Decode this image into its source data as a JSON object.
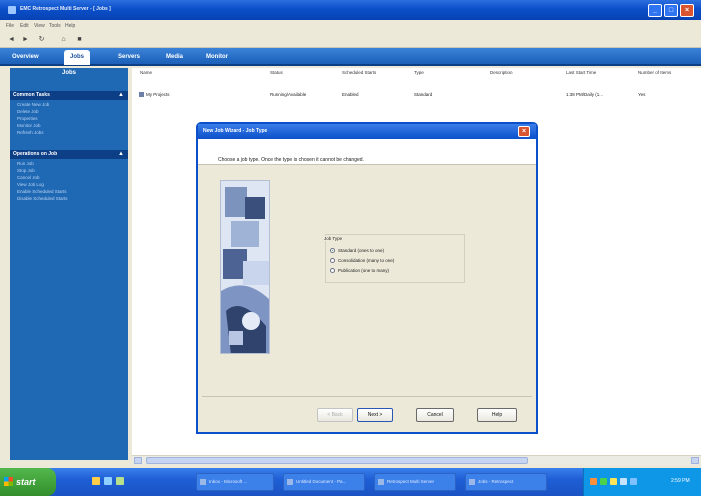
{
  "window": {
    "title": "EMC Retrospect Multi Server - [ Jobs ]"
  },
  "menu": [
    "File",
    "Edit",
    "View",
    "Tools",
    "Help"
  ],
  "toolbar": {
    "back": "◄",
    "forward": "►",
    "refresh": "↻",
    "home": "⌂",
    "stop": "■"
  },
  "nav": {
    "tabs": [
      "Overview",
      "Jobs",
      "Servers",
      "Media",
      "Monitor"
    ],
    "active": "Jobs"
  },
  "sidebar": {
    "title": "Jobs",
    "groups": [
      {
        "label": "Common Tasks",
        "items": [
          "Create New Job",
          "Delete Job",
          "Properties",
          "Monitor Job",
          "Refresh Jobs"
        ]
      },
      {
        "label": "Operations on Job",
        "items": [
          "Run Job",
          "Stop Job",
          "Cancel Job",
          "View Job Log",
          "Enable Scheduled Starts",
          "Disable Scheduled Starts"
        ]
      }
    ]
  },
  "table": {
    "columns": [
      "Name",
      "Status",
      "Scheduled Starts",
      "Type",
      "Description",
      "Last Start Time",
      "Number of Items"
    ],
    "rows": [
      {
        "name": "My Projects",
        "status": "Running/Available",
        "scheduled": "Enabled",
        "type": "Standard",
        "description": "",
        "last_start": "1:38 PM/Daily (1...",
        "items": "Yes"
      }
    ]
  },
  "dialog": {
    "title": "New Job Wizard - Job Type",
    "question": "Choose a job type. Once the type is chosen it cannot be changed.",
    "group_label": "Job Type",
    "options": [
      {
        "label": "Standard (ones to one)",
        "selected": true
      },
      {
        "label": "Consolidation (many to one)",
        "selected": false
      },
      {
        "label": "Publication (one to many)",
        "selected": false
      }
    ],
    "buttons": {
      "back": "< Back",
      "next": "Next >",
      "cancel": "Cancel",
      "help": "Help"
    }
  },
  "taskbar": {
    "start": "start",
    "tasks": [
      "Inbox - Microsoft ...",
      "Untitled Document - Pa...",
      "Retrospect Multi Server",
      "Jobs - Retrospect"
    ],
    "clock": "2:59 PM"
  },
  "colors": {
    "title_blue": "#0a4fc9",
    "sidebar_blue": "#1f68b4",
    "taskbar_blue": "#1f5fd6",
    "start_green": "#328e2b"
  }
}
